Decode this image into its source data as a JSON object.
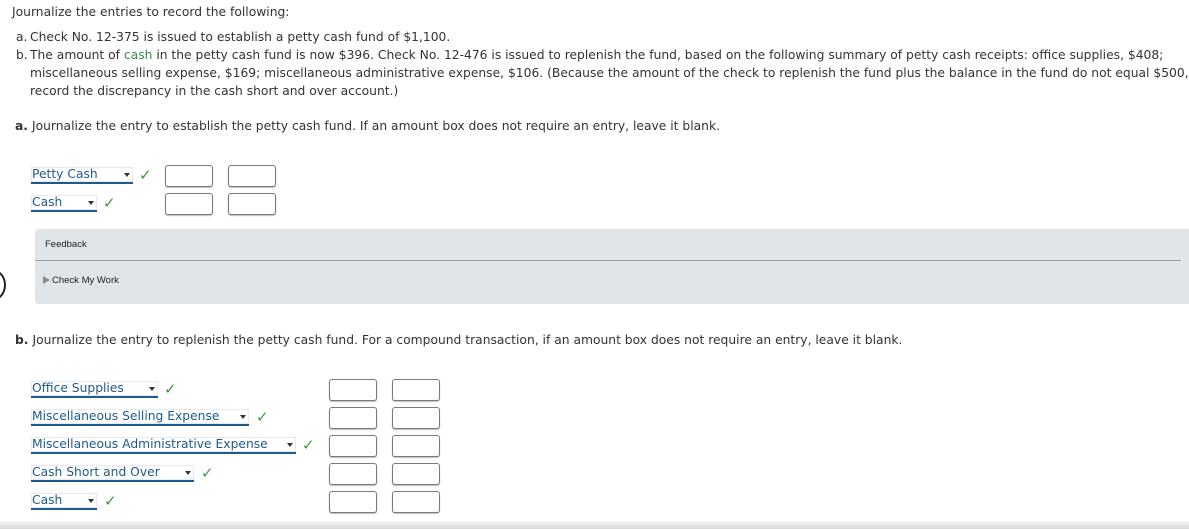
{
  "problem": {
    "intro": "Journalize the entries to record the following:",
    "items": [
      {
        "label": "a.",
        "text": "Check No. 12-375 is issued to establish a petty cash fund of $1,100."
      },
      {
        "label": "b.",
        "text_before_link": "The amount of ",
        "link_text": "cash",
        "text_after_link_line1": " in the petty cash fund is now $396. Check No. 12-476 is issued to replenish the fund, based on the following summary of petty cash receipts: office supplies, $408;",
        "line2": "miscellaneous selling expense, $169; miscellaneous administrative expense, $106. (Because the amount of the check to replenish the fund plus the balance in the fund do not equal $500,",
        "line3": "record the discrepancy in the cash short and over account.)"
      }
    ]
  },
  "part_a": {
    "label": "a.",
    "instruction": "Journalize the entry to establish the petty cash fund. If an amount box does not require an entry, leave it blank.",
    "rows": [
      {
        "account": "Petty Cash",
        "status": "correct",
        "debit": "",
        "credit": ""
      },
      {
        "account": "Cash",
        "status": "correct",
        "debit": "",
        "credit": ""
      }
    ]
  },
  "feedback": {
    "title": "Feedback",
    "check_my_work": "Check My Work"
  },
  "part_b": {
    "label": "b.",
    "instruction": "Journalize the entry to replenish the petty cash fund. For a compound transaction, if an amount box does not require an entry, leave it blank.",
    "rows": [
      {
        "account": "Office Supplies",
        "status": "correct",
        "debit": "",
        "credit": ""
      },
      {
        "account": "Miscellaneous Selling Expense",
        "status": "correct",
        "debit": "",
        "credit": ""
      },
      {
        "account": "Miscellaneous Administrative Expense",
        "status": "correct",
        "debit": "",
        "credit": ""
      },
      {
        "account": "Cash Short and Over",
        "status": "correct",
        "debit": "",
        "credit": ""
      },
      {
        "account": "Cash",
        "status": "correct",
        "debit": "",
        "credit": ""
      }
    ]
  },
  "icons": {
    "check": "✓"
  },
  "colors": {
    "account_link": "#1f5a8c",
    "correct_check": "#3a9a3a",
    "glossary_link": "#3a8a4a",
    "feedback_bg": "#dfe5e9"
  }
}
